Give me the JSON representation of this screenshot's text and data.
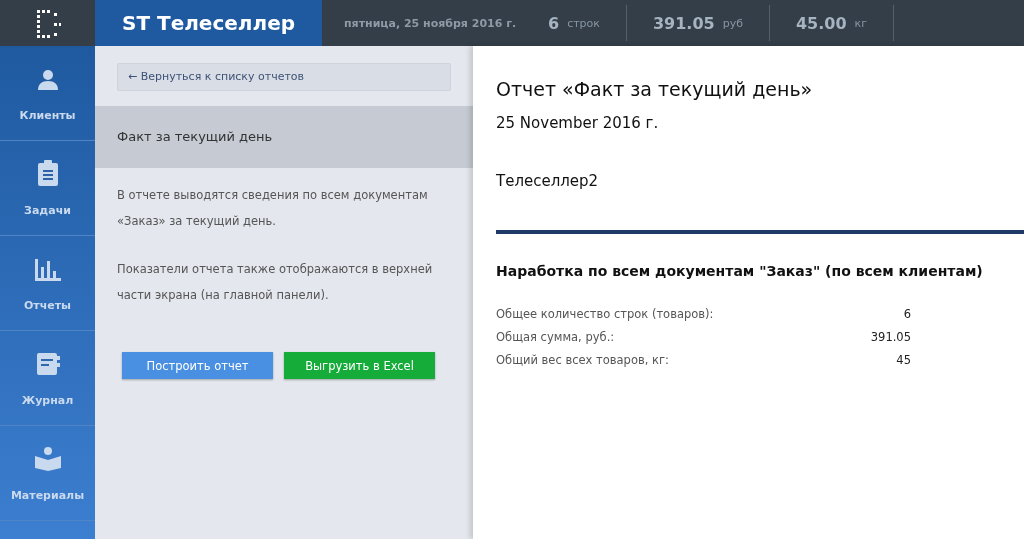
{
  "header": {
    "title": "ST Телеселлер",
    "date": "пятница, 25 ноября 2016 г.",
    "stats": [
      {
        "value": "6",
        "unit": "строк"
      },
      {
        "value": "391.05",
        "unit": "руб"
      },
      {
        "value": "45.00",
        "unit": "кг"
      }
    ]
  },
  "sidebar": {
    "items": [
      {
        "kind": "person",
        "label": "Клиенты"
      },
      {
        "kind": "clipboard",
        "label": "Задачи"
      },
      {
        "kind": "chart",
        "label": "Отчеты"
      },
      {
        "kind": "notebook",
        "label": "Журнал"
      },
      {
        "kind": "reader",
        "label": "Материалы"
      }
    ]
  },
  "reports_panel": {
    "back_link": "← Вернуться к списку отчетов",
    "reports": [
      {
        "title": "Факт за текущий день",
        "selected": true
      }
    ],
    "description": [
      "В отчете выводятся сведения по всем документам «Заказ» за текущий день.",
      "Показатели отчета также отображаются в верхней части экрана (на главной панели)."
    ],
    "buttons": [
      {
        "kind": "primary",
        "label": "Построить отчет"
      },
      {
        "kind": "excel",
        "label": "Выгрузить в Excel"
      }
    ]
  },
  "report": {
    "title": "Отчет «Факт за текущий день»",
    "date": "25 November 2016 г.",
    "user": "Телеселлер2",
    "section_title": "Наработка по всем документам \"Заказ\" (по всем клиентам)",
    "rows": [
      {
        "label": "Общее количество строк (товаров):",
        "value": "6"
      },
      {
        "label": "Общая сумма, руб.:",
        "value": "391.05"
      },
      {
        "label": "Общий вес всех товаров, кг:",
        "value": "45"
      }
    ]
  }
}
